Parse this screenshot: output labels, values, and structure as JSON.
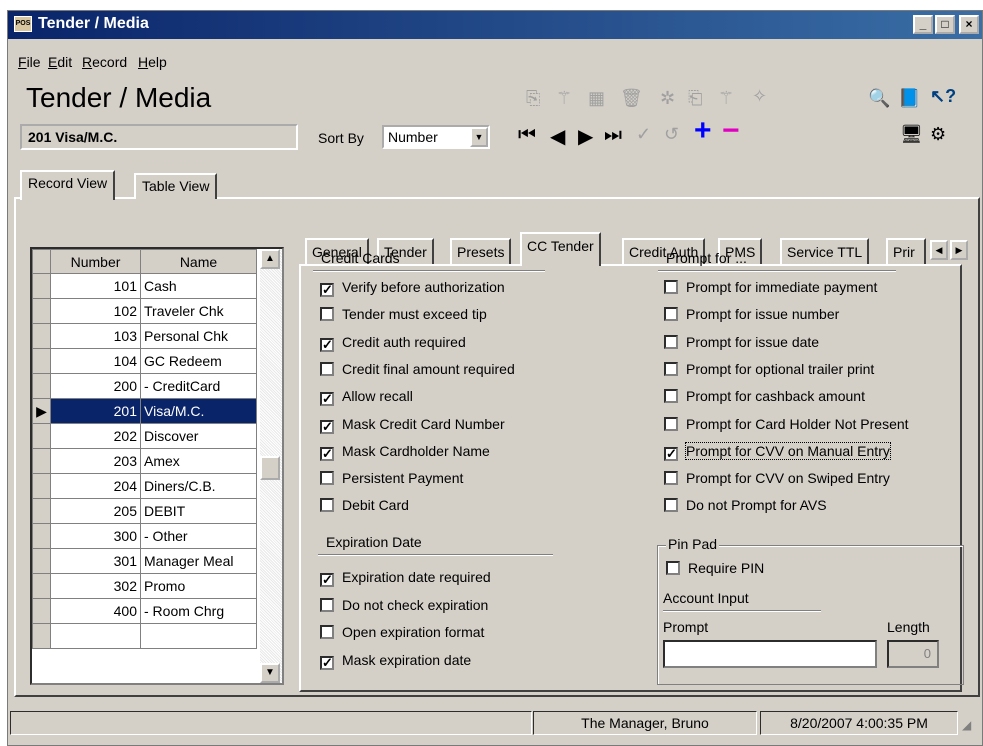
{
  "window": {
    "title": "Tender / Media",
    "app_icon_text": "POS"
  },
  "menu": [
    "File",
    "Edit",
    "Record",
    "Help"
  ],
  "header": {
    "page_title": "Tender / Media",
    "current_record": "201 Visa/M.C.",
    "sort_by_label": "Sort By",
    "sort_by_value": "Number"
  },
  "outer_tabs": [
    "Record View",
    "Table View"
  ],
  "grid": {
    "columns": [
      "Number",
      "Name"
    ],
    "rows": [
      {
        "number": "101",
        "name": "Cash"
      },
      {
        "number": "102",
        "name": "Traveler Chk"
      },
      {
        "number": "103",
        "name": "Personal Chk"
      },
      {
        "number": "104",
        "name": "GC Redeem"
      },
      {
        "number": "200",
        "name": "- CreditCard"
      },
      {
        "number": "201",
        "name": "Visa/M.C."
      },
      {
        "number": "202",
        "name": "Discover"
      },
      {
        "number": "203",
        "name": "Amex"
      },
      {
        "number": "204",
        "name": "Diners/C.B."
      },
      {
        "number": "205",
        "name": "DEBIT"
      },
      {
        "number": "300",
        "name": "- Other"
      },
      {
        "number": "301",
        "name": "Manager Meal"
      },
      {
        "number": "302",
        "name": "Promo"
      },
      {
        "number": "400",
        "name": "- Room Chrg"
      }
    ],
    "selected_index": 5
  },
  "inner_tabs": [
    "General",
    "Tender",
    "Presets",
    "CC Tender",
    "Credit Auth",
    "PMS",
    "Service TTL",
    "Prir"
  ],
  "active_inner_tab": "CC Tender",
  "credit_cards": {
    "title": "Credit Cards",
    "items": [
      {
        "label": "Verify before authorization",
        "checked": true
      },
      {
        "label": "Tender must exceed tip",
        "checked": false
      },
      {
        "label": "Credit auth required",
        "checked": true
      },
      {
        "label": "Credit final amount required",
        "checked": false
      },
      {
        "label": "Allow recall",
        "checked": true
      },
      {
        "label": "Mask Credit Card Number",
        "checked": true
      },
      {
        "label": "Mask Cardholder Name",
        "checked": true
      },
      {
        "label": "Persistent Payment",
        "checked": false
      },
      {
        "label": "Debit Card",
        "checked": false
      }
    ]
  },
  "expiration": {
    "title": "Expiration Date",
    "items": [
      {
        "label": "Expiration date required",
        "checked": true
      },
      {
        "label": "Do not check expiration",
        "checked": false
      },
      {
        "label": "Open expiration format",
        "checked": false
      },
      {
        "label": "Mask expiration date",
        "checked": true
      }
    ]
  },
  "prompt_for": {
    "title": "Prompt for ...",
    "items": [
      {
        "label": "Prompt for immediate payment",
        "checked": false
      },
      {
        "label": "Prompt for issue number",
        "checked": false
      },
      {
        "label": "Prompt for issue date",
        "checked": false
      },
      {
        "label": "Prompt for optional trailer print",
        "checked": false
      },
      {
        "label": "Prompt for cashback amount",
        "checked": false
      },
      {
        "label": "Prompt for Card Holder Not Present",
        "checked": false
      },
      {
        "label": "Prompt for CVV on Manual Entry",
        "checked": true
      },
      {
        "label": "Prompt for CVV on Swiped Entry",
        "checked": false
      },
      {
        "label": "Do not Prompt for AVS",
        "checked": false
      }
    ]
  },
  "pin_pad": {
    "title": "Pin Pad",
    "require_pin": {
      "label": "Require PIN",
      "checked": false
    },
    "account_input_label": "Account Input",
    "prompt_label": "Prompt",
    "prompt_value": "",
    "length_label": "Length",
    "length_value": "0"
  },
  "status": {
    "user": "The Manager, Bruno",
    "datetime": "8/20/2007 4:00:35 PM"
  }
}
